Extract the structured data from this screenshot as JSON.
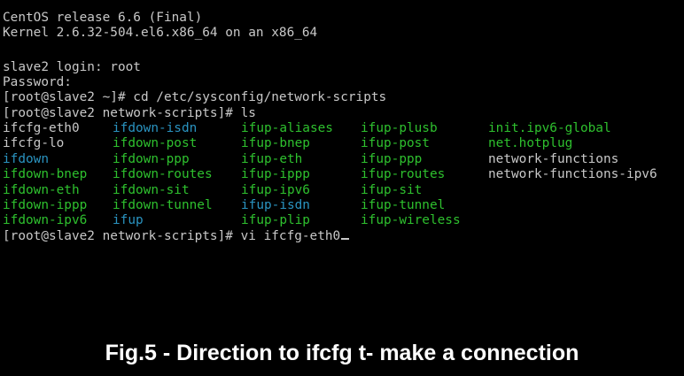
{
  "terminal": {
    "lines": [
      "CentOS release 6.6 (Final)",
      "Kernel 2.6.32-504.el6.x86_64 on an x86_64",
      "",
      "slave2 login: root",
      "Password:",
      "[root@slave2 ~]# cd /etc/sysconfig/network-scripts",
      "[root@slave2 network-scripts]# ls"
    ],
    "ls_rows": [
      [
        {
          "text": "ifcfg-eth0",
          "color": "white"
        },
        {
          "text": "ifdown-isdn",
          "color": "blue"
        },
        {
          "text": "ifup-aliases",
          "color": "green"
        },
        {
          "text": "ifup-plusb",
          "color": "green"
        },
        {
          "text": "init.ipv6-global",
          "color": "green"
        }
      ],
      [
        {
          "text": "ifcfg-lo",
          "color": "white"
        },
        {
          "text": "ifdown-post",
          "color": "green"
        },
        {
          "text": "ifup-bnep",
          "color": "green"
        },
        {
          "text": "ifup-post",
          "color": "green"
        },
        {
          "text": "net.hotplug",
          "color": "green"
        }
      ],
      [
        {
          "text": "ifdown",
          "color": "blue"
        },
        {
          "text": "ifdown-ppp",
          "color": "green"
        },
        {
          "text": "ifup-eth",
          "color": "green"
        },
        {
          "text": "ifup-ppp",
          "color": "green"
        },
        {
          "text": "network-functions",
          "color": "white"
        }
      ],
      [
        {
          "text": "ifdown-bnep",
          "color": "green"
        },
        {
          "text": "ifdown-routes",
          "color": "green"
        },
        {
          "text": "ifup-ippp",
          "color": "green"
        },
        {
          "text": "ifup-routes",
          "color": "green"
        },
        {
          "text": "network-functions-ipv6",
          "color": "white"
        }
      ],
      [
        {
          "text": "ifdown-eth",
          "color": "green"
        },
        {
          "text": "ifdown-sit",
          "color": "green"
        },
        {
          "text": "ifup-ipv6",
          "color": "green"
        },
        {
          "text": "ifup-sit",
          "color": "green"
        }
      ],
      [
        {
          "text": "ifdown-ippp",
          "color": "green"
        },
        {
          "text": "ifdown-tunnel",
          "color": "green"
        },
        {
          "text": "ifup-isdn",
          "color": "blue"
        },
        {
          "text": "ifup-tunnel",
          "color": "green"
        }
      ],
      [
        {
          "text": "ifdown-ipv6",
          "color": "green"
        },
        {
          "text": "ifup",
          "color": "blue"
        },
        {
          "text": "ifup-plip",
          "color": "green"
        },
        {
          "text": "ifup-wireless",
          "color": "green"
        }
      ]
    ],
    "final_prompt": "[root@slave2 network-scripts]# vi ifcfg-eth0"
  },
  "caption": "Fig.5 - Direction to ifcfg t- make a connection",
  "colors": {
    "background": "#000000",
    "text": "#c8c8c8",
    "green": "#2ec02e",
    "blue": "#2a93c0",
    "caption": "#ffffff"
  }
}
